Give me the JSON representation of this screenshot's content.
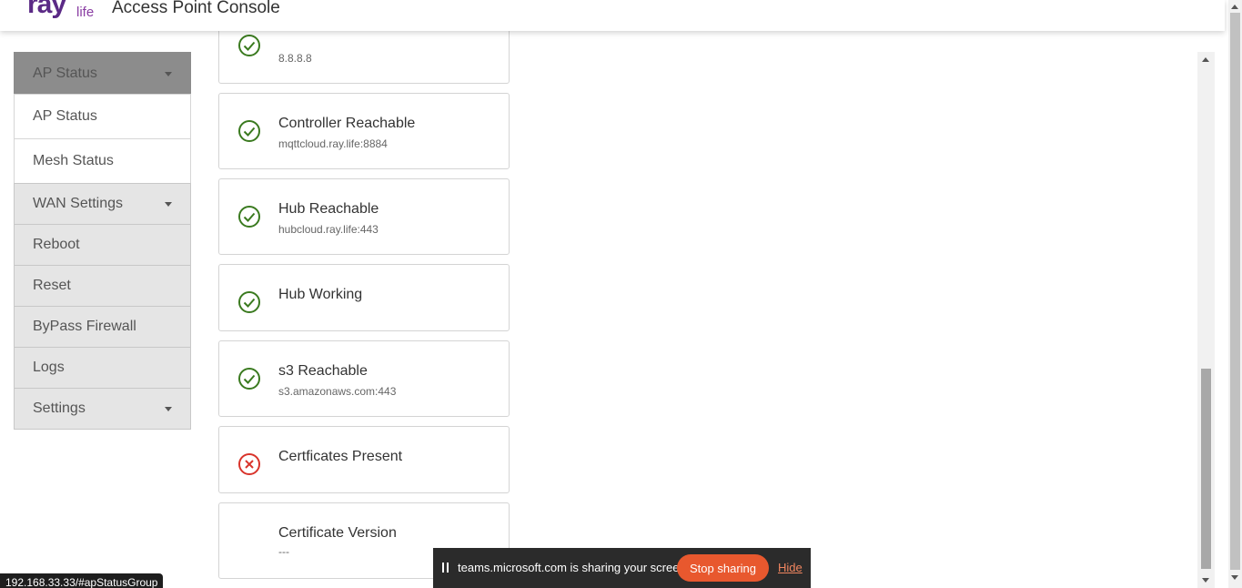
{
  "header": {
    "logo_main": "ray",
    "logo_suffix": "life",
    "app_title": "Access Point Console"
  },
  "sidebar": {
    "items": [
      {
        "label": "AP Status",
        "state": "expanded-group-header",
        "has_caret": true
      },
      {
        "label": "AP Status",
        "state": "submenu"
      },
      {
        "label": "Mesh Status",
        "state": "submenu"
      },
      {
        "label": "WAN Settings",
        "has_caret": true
      },
      {
        "label": "Reboot"
      },
      {
        "label": "Reset"
      },
      {
        "label": "ByPass Firewall"
      },
      {
        "label": "Logs"
      },
      {
        "label": "Settings",
        "has_caret": true
      }
    ]
  },
  "checks": [
    {
      "title": "",
      "detail": "8.8.8.8",
      "status": "ok"
    },
    {
      "title": "Controller Reachable",
      "detail": "mqttcloud.ray.life:8884",
      "status": "ok"
    },
    {
      "title": "Hub Reachable",
      "detail": "hubcloud.ray.life:443",
      "status": "ok"
    },
    {
      "title": "Hub Working",
      "detail": "",
      "status": "ok"
    },
    {
      "title": "s3 Reachable",
      "detail": "s3.amazonaws.com:443",
      "status": "ok"
    },
    {
      "title": "Certficates Present",
      "detail": "",
      "status": "error"
    },
    {
      "title": "Certificate Version",
      "detail": "---",
      "status": "none"
    }
  ],
  "colors": {
    "ok": "#3a7a1f",
    "error": "#d9342b",
    "brand": "#5b2a86",
    "stop_button": "#e8582e"
  },
  "status_url": "192.168.33.33/#apStatusGroup",
  "share_bar": {
    "message": "teams.microsoft.com is sharing your screen.",
    "stop_label": "Stop sharing",
    "hide_label": "Hide"
  }
}
